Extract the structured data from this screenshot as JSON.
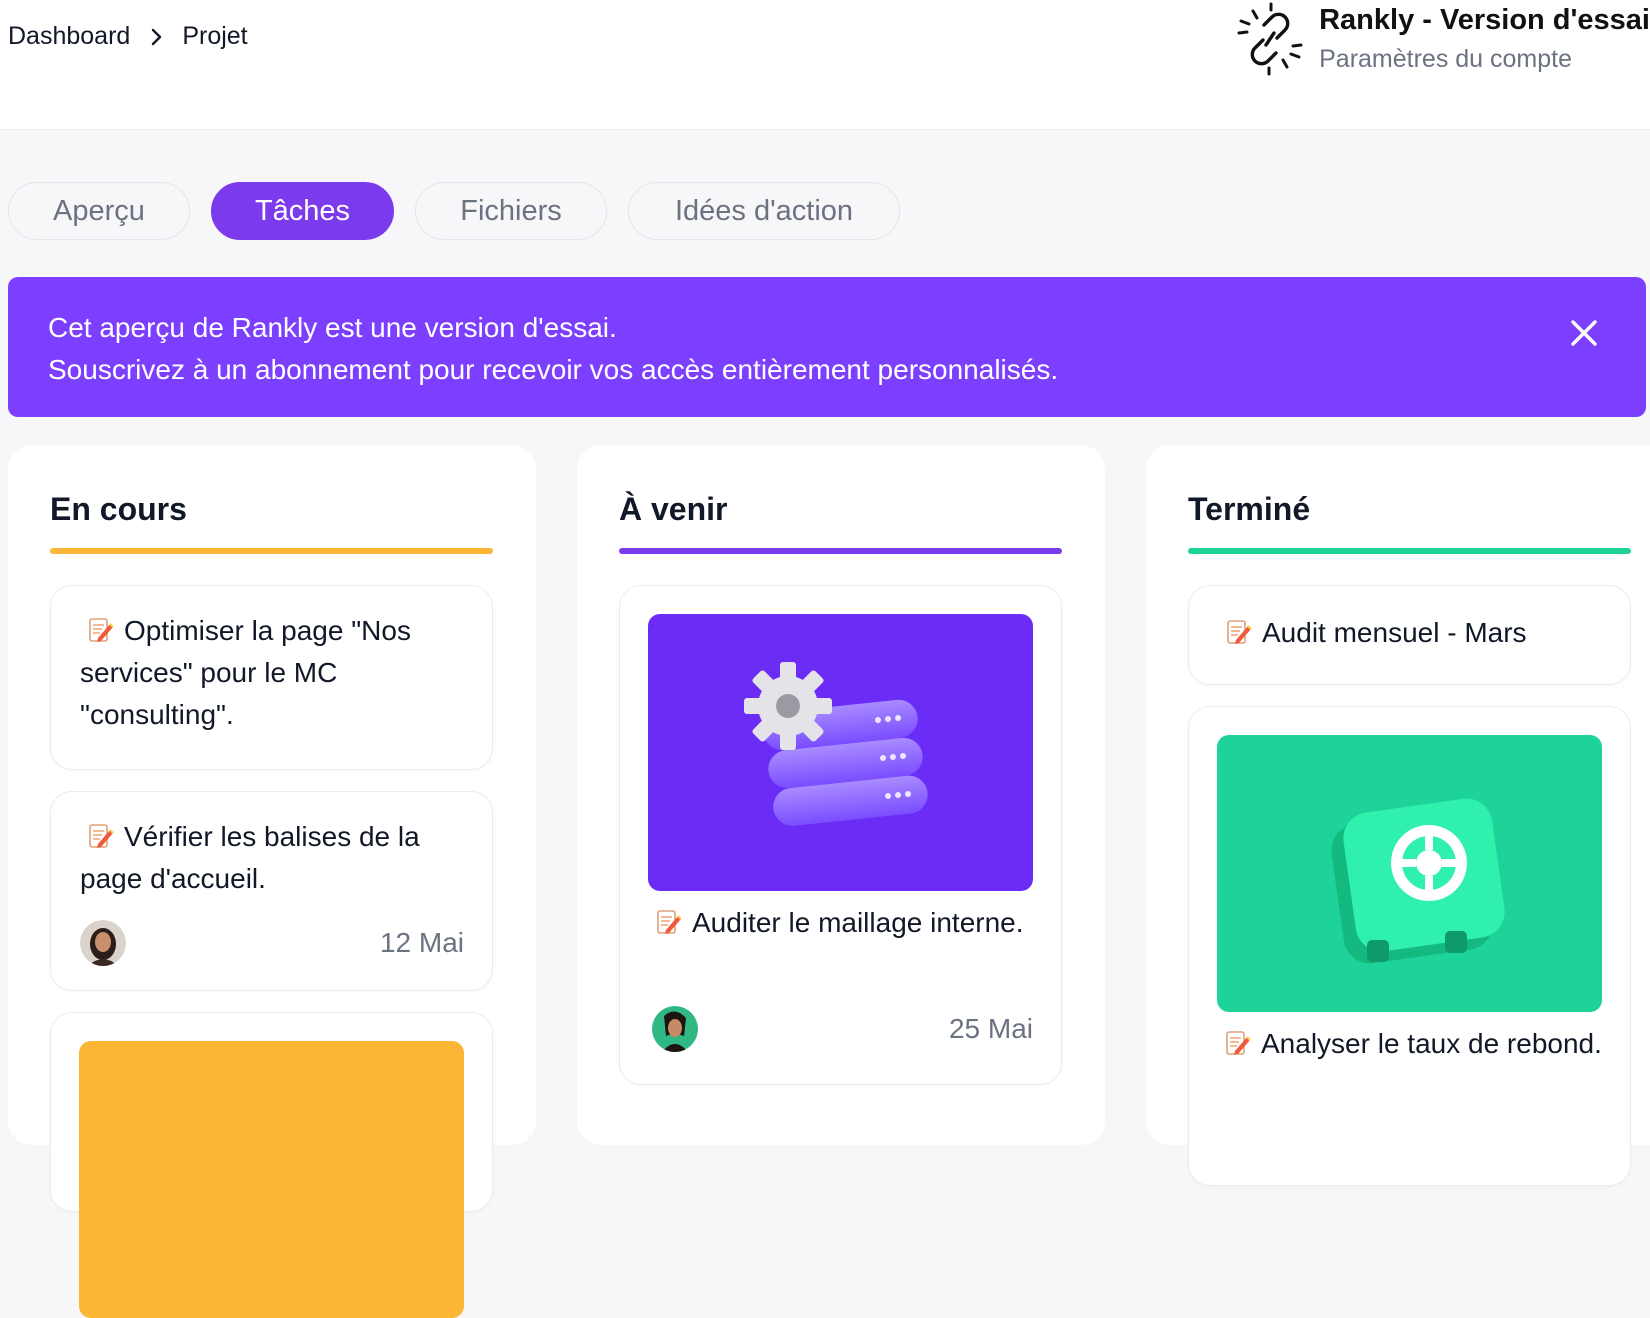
{
  "breadcrumb": {
    "items": [
      "Dashboard",
      "Projet"
    ]
  },
  "account": {
    "title": "Rankly - Version d'essai",
    "subtitle": "Paramètres du compte",
    "logo_icon": "rankly-logo-icon"
  },
  "tabs": [
    {
      "label": "Aperçu",
      "active": false
    },
    {
      "label": "Tâches",
      "active": true
    },
    {
      "label": "Fichiers",
      "active": false
    },
    {
      "label": "Idées d'action",
      "active": false
    }
  ],
  "banner": {
    "line1": "Cet aperçu de Rankly est une version d'essai.",
    "line2": "Souscrivez à un abonnement pour recevoir vos accès entièrement personnalisés.",
    "close_icon": "close-icon"
  },
  "colors": {
    "accent": "#7c3aed",
    "banner": "#7c3fff",
    "in_progress": "#fbb636",
    "upcoming": "#7c3aed",
    "done": "#1ed39a"
  },
  "columns": [
    {
      "title": "En cours",
      "cards": [
        {
          "text": "Optimiser la page \"Nos services\" pour le MC \"consulting\"."
        },
        {
          "text": "Vérifier les balises de la page d'accueil.",
          "date": "12 Mai"
        },
        {
          "text": ""
        }
      ]
    },
    {
      "title": "À venir",
      "cards": [
        {
          "text": "Auditer le maillage interne.",
          "date": "25 Mai"
        }
      ]
    },
    {
      "title": "Terminé",
      "cards": [
        {
          "text": "Audit mensuel - Mars"
        },
        {
          "text": "Analyser le taux de rebond."
        }
      ]
    }
  ]
}
